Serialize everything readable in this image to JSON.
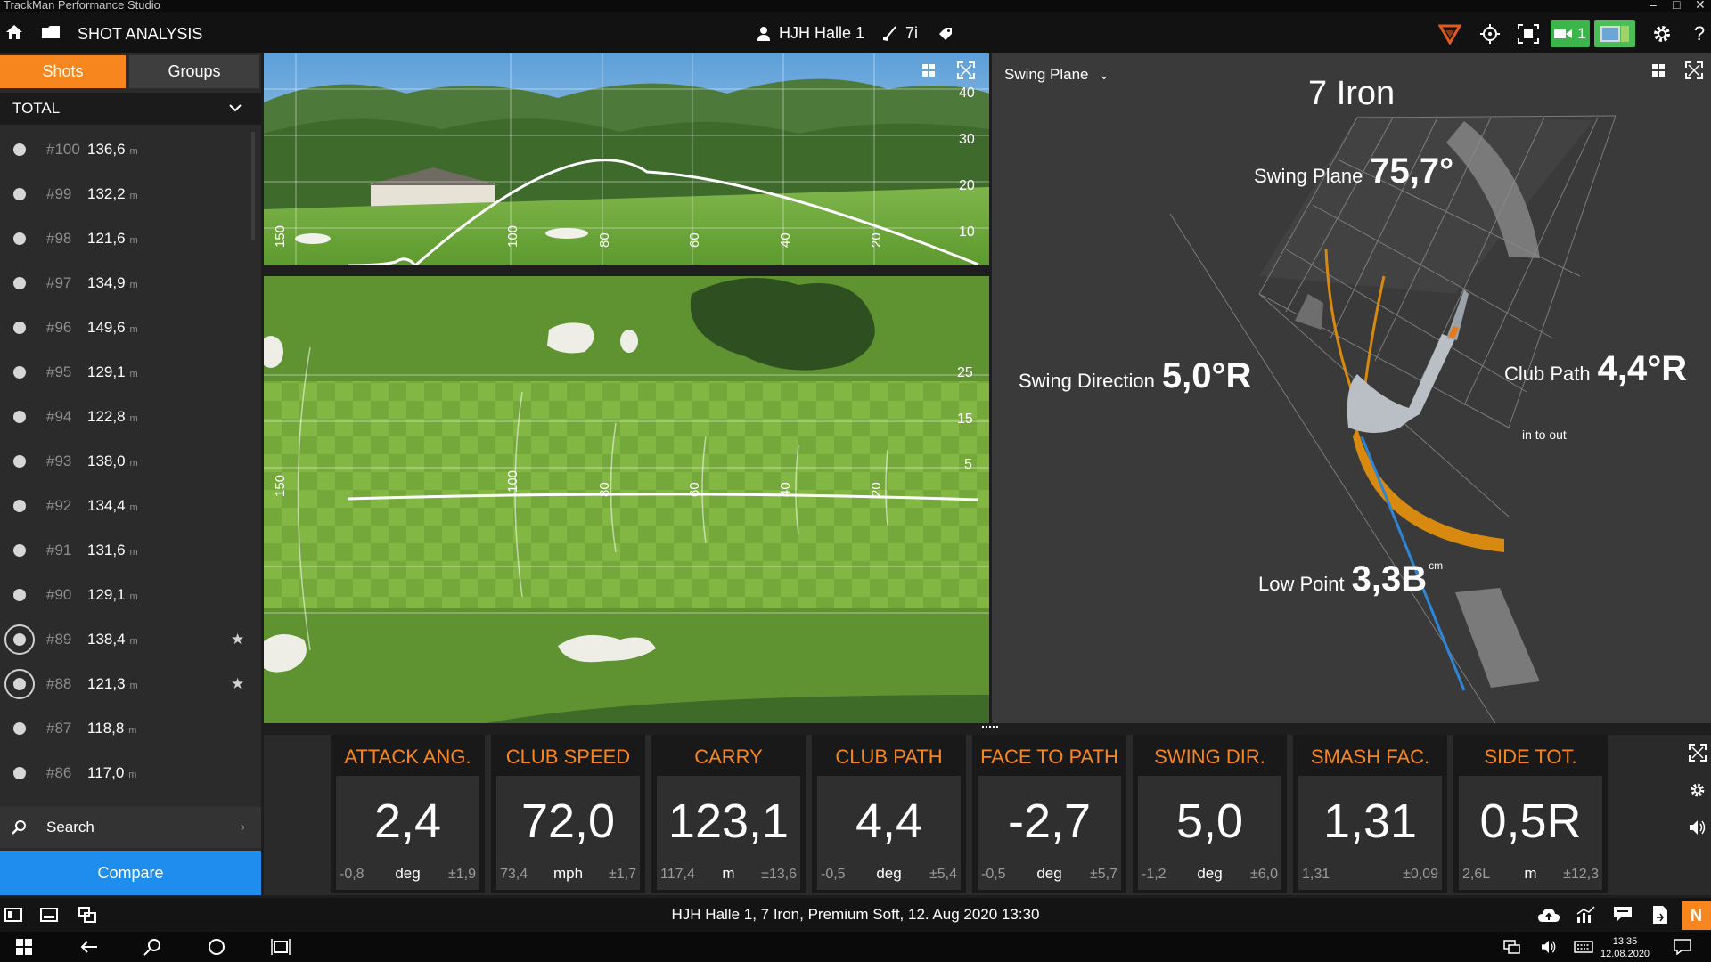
{
  "app": {
    "title": "TrackMan Performance Studio",
    "win_controls": [
      "–",
      "□",
      "✕"
    ]
  },
  "toolbar": {
    "section_title": "SHOT ANALYSIS",
    "bay": "HJH Halle 1",
    "club": "7i",
    "camera_count": "1"
  },
  "left_panel": {
    "tabs": [
      {
        "label": "Shots",
        "active": true
      },
      {
        "label": "Groups",
        "active": false
      }
    ],
    "filter": "TOTAL",
    "unit": "m",
    "shots": [
      {
        "num": "#100",
        "value": "136,6",
        "selected": false,
        "starred": false
      },
      {
        "num": "#99",
        "value": "132,2",
        "selected": false,
        "starred": false
      },
      {
        "num": "#98",
        "value": "121,6",
        "selected": false,
        "starred": false
      },
      {
        "num": "#97",
        "value": "134,9",
        "selected": false,
        "starred": false
      },
      {
        "num": "#96",
        "value": "149,6",
        "selected": false,
        "starred": false
      },
      {
        "num": "#95",
        "value": "129,1",
        "selected": false,
        "starred": false
      },
      {
        "num": "#94",
        "value": "122,8",
        "selected": false,
        "starred": false
      },
      {
        "num": "#93",
        "value": "138,0",
        "selected": false,
        "starred": false
      },
      {
        "num": "#92",
        "value": "134,4",
        "selected": false,
        "starred": false
      },
      {
        "num": "#91",
        "value": "131,6",
        "selected": false,
        "starred": false
      },
      {
        "num": "#90",
        "value": "129,1",
        "selected": false,
        "starred": false
      },
      {
        "num": "#89",
        "value": "138,4",
        "selected": true,
        "starred": true
      },
      {
        "num": "#88",
        "value": "121,3",
        "selected": true,
        "starred": true
      },
      {
        "num": "#87",
        "value": "118,8",
        "selected": false,
        "starred": false
      },
      {
        "num": "#86",
        "value": "117,0",
        "selected": false,
        "starred": false
      }
    ],
    "search_label": "Search",
    "compare_label": "Compare"
  },
  "side_view": {
    "height_labels": [
      "40",
      "30",
      "20",
      "10"
    ],
    "distance_labels": [
      "150",
      "100",
      "80",
      "60",
      "40",
      "20"
    ]
  },
  "top_view": {
    "side_labels": [
      "25",
      "15",
      "5"
    ],
    "distance_labels": [
      "150",
      "100",
      "80",
      "60",
      "40",
      "20"
    ]
  },
  "swing_plane": {
    "dropdown": "Swing Plane",
    "title": "7 Iron",
    "plane_label": "Swing Plane",
    "plane_value": "75,7°",
    "direction_label": "Swing Direction",
    "direction_value": "5,0°R",
    "path_label": "Club Path",
    "path_sub": "in to out",
    "path_value": "4,4°R",
    "low_point_label": "Low Point",
    "low_point_value": "3,3B",
    "low_point_unit": "cm"
  },
  "tiles": [
    {
      "label": "ATTACK ANG.",
      "value": "2,4",
      "low": "-0,8",
      "unit": "deg",
      "sd": "±1,9"
    },
    {
      "label": "CLUB SPEED",
      "value": "72,0",
      "low": "73,4",
      "unit": "mph",
      "sd": "±1,7"
    },
    {
      "label": "CARRY",
      "value": "123,1",
      "low": "117,4",
      "unit": "m",
      "sd": "±13,6"
    },
    {
      "label": "CLUB PATH",
      "value": "4,4",
      "low": "-0,5",
      "unit": "deg",
      "sd": "±5,4"
    },
    {
      "label": "FACE TO PATH",
      "value": "-2,7",
      "low": "-0,5",
      "unit": "deg",
      "sd": "±5,7"
    },
    {
      "label": "SWING DIR.",
      "value": "5,0",
      "low": "-1,2",
      "unit": "deg",
      "sd": "±6,0"
    },
    {
      "label": "SMASH FAC.",
      "value": "1,31",
      "low": "1,31",
      "unit": "",
      "sd": "±0,09"
    },
    {
      "label": "SIDE TOT.",
      "value": "0,5R",
      "low": "2,6L",
      "unit": "m",
      "sd": "±12,3"
    }
  ],
  "status_bar": {
    "text": "HJH Halle 1, 7 Iron, Premium Soft, 12. Aug 2020 13:30",
    "badge": "N"
  },
  "taskbar": {
    "time": "13:35",
    "date": "12.08.2020"
  },
  "colors": {
    "accent": "#f7861e",
    "compare": "#1f8ded",
    "camera_green": "#3cb54a",
    "club_path": "#d8890f"
  }
}
